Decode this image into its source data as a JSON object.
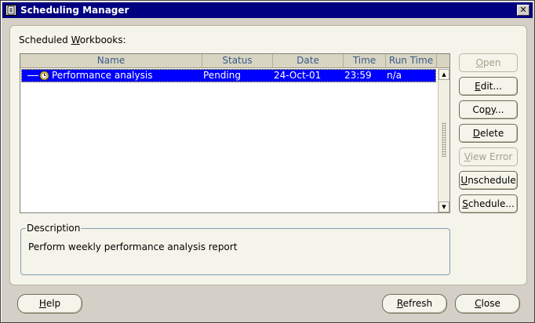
{
  "window": {
    "title": "Scheduling Manager",
    "close_glyph": "✕"
  },
  "scheduled": {
    "label_pre": "Scheduled ",
    "label_key": "W",
    "label_post": "orkbooks:"
  },
  "table": {
    "columns": [
      "Name",
      "Status",
      "Date",
      "Time",
      "Run Time"
    ],
    "rows": [
      {
        "icon": "clock-icon",
        "name": "Performance analysis",
        "status": "Pending",
        "date": "24-Oct-01",
        "time": "23:59",
        "run_time": "n/a",
        "selected": true
      }
    ]
  },
  "description": {
    "legend": "Description",
    "text": "Perform weekly performance analysis report"
  },
  "buttons": {
    "open": {
      "key": "O",
      "rest": "pen",
      "enabled": false
    },
    "edit": {
      "key": "E",
      "rest": "dit...",
      "enabled": true
    },
    "copy_pre": "Co",
    "copy_key": "p",
    "copy_post": "y...",
    "delete": {
      "key": "D",
      "rest": "elete",
      "enabled": true
    },
    "view_error": {
      "key": "V",
      "rest": "iew Error",
      "enabled": false
    },
    "unschedule": {
      "key": "U",
      "rest": "nschedule",
      "enabled": true
    },
    "schedule": {
      "key": "S",
      "rest": "chedule...",
      "enabled": true
    },
    "help": {
      "key": "H",
      "rest": "elp"
    },
    "refresh": {
      "key": "R",
      "rest": "efresh"
    },
    "close": {
      "key": "C",
      "rest": "lose"
    }
  },
  "colors": {
    "title_bar": "#000080",
    "selection": "#0000ff",
    "header_text": "#3a5a8a",
    "disabled_text": "#a3a08c"
  }
}
